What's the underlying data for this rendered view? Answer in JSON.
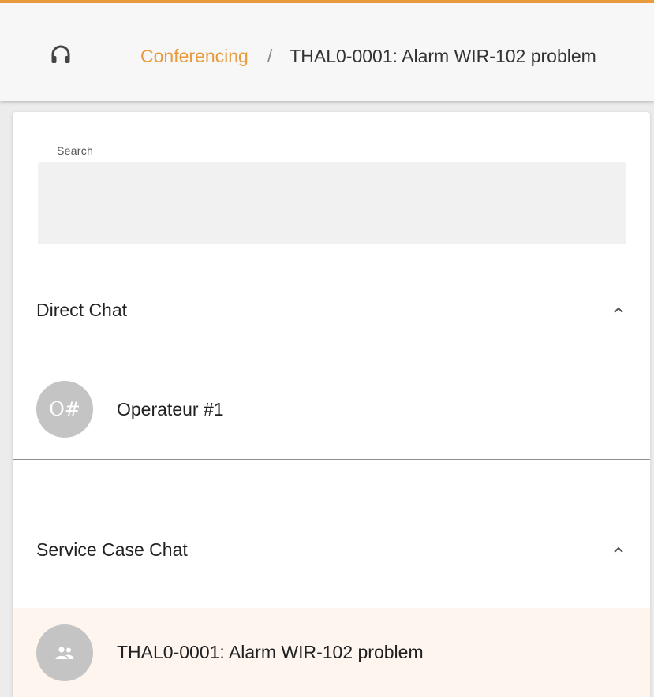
{
  "header": {
    "breadcrumb_link": "Conferencing",
    "breadcrumb_separator": "/",
    "breadcrumb_current": "THAL0-0001: Alarm WIR-102 problem",
    "accent_color": "#e89a3c"
  },
  "search": {
    "label": "Search",
    "value": "",
    "placeholder": ""
  },
  "direct_chat": {
    "title": "Direct Chat",
    "expanded": true,
    "items": [
      {
        "initials": "O#",
        "name": "Operateur #1"
      }
    ]
  },
  "service_case_chat": {
    "title": "Service Case Chat",
    "expanded": true,
    "items": [
      {
        "icon": "group-icon",
        "name": "THAL0-0001: Alarm WIR-102 problem",
        "selected": true
      }
    ]
  }
}
